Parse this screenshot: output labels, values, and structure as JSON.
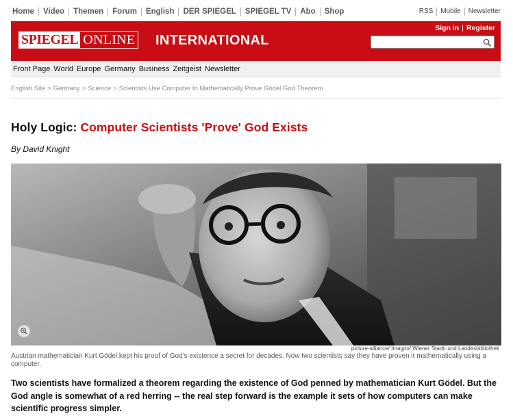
{
  "top_nav": {
    "items": [
      "Home",
      "Video",
      "Themen",
      "Forum",
      "English",
      "DER SPIEGEL",
      "SPIEGEL TV",
      "Abo",
      "Shop"
    ],
    "right": [
      "RSS",
      "Mobile",
      "Newsletter"
    ]
  },
  "header": {
    "logo_left": "SPIEGEL",
    "logo_right": "ONLINE",
    "section_title": "INTERNATIONAL",
    "signin": "Sign in",
    "register": "Register",
    "search_value": "",
    "brand_color": "#c80e14"
  },
  "section_nav": [
    "Front Page",
    "World",
    "Europe",
    "Germany",
    "Business",
    "Zeitgeist",
    "Newsletter"
  ],
  "breadcrumb": [
    "English Site",
    "Germany",
    "Science",
    "Scientists Use Computer to Mathematically Prove Gödel God Theorem"
  ],
  "article": {
    "kicker": "Holy Logic:",
    "title": "Computer Scientists 'Prove' God Exists",
    "byline": "By David Knight",
    "photo_credit": "picture-alliance/ Imagno/ Wiener Stadt- und Landesbibliothek",
    "caption": "Austrian mathematician Kurt Gödel kept his proof of God's existence a secret for decades. Now two scientists say they have proven it mathematically using a computer.",
    "lead": "Two scientists have formalized a theorem regarding the existence of God penned by mathematician Kurt Gödel. But the God angle is somewhat of a red herring -- the real step forward is the example it sets of how computers can make scientific progress simpler."
  },
  "icons": {
    "search": "magnifier-icon",
    "zoom": "zoom-in-icon"
  }
}
